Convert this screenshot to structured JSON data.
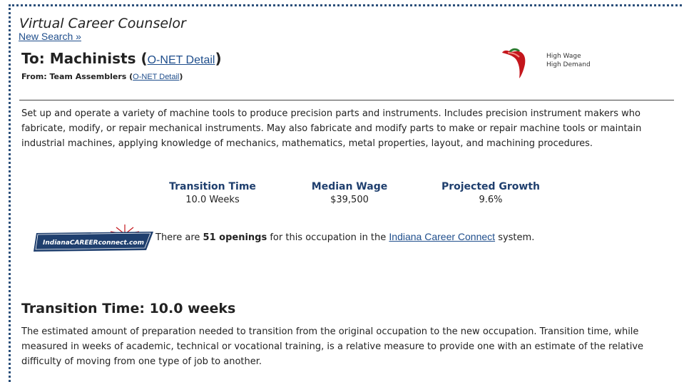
{
  "header": {
    "app_title": "Virtual Career Counselor",
    "new_search_label": "New Search »"
  },
  "occupation": {
    "to_prefix": "To: Machinists (",
    "to_suffix": ")",
    "from_prefix": "From: Team Assemblers (",
    "from_suffix": ")",
    "onet_link_label": "O-NET Detail"
  },
  "badge": {
    "icon": "chili-pepper-icon",
    "line1": "High Wage",
    "line2": "High Demand",
    "color": "#c4161c"
  },
  "description": "Set up and operate a variety of machine tools to produce precision parts and instruments. Includes precision instrument makers who fabricate, modify, or repair mechanical instruments. May also fabricate and modify parts to make or repair machine tools or maintain industrial machines, applying knowledge of mechanics, mathematics, metal properties, layout, and machining procedures.",
  "stats": [
    {
      "label": "Transition Time",
      "value": "10.0 Weeks"
    },
    {
      "label": "Median Wage",
      "value": "$39,500"
    },
    {
      "label": "Projected Growth",
      "value": "9.6%"
    }
  ],
  "openings": {
    "logo_text": "IndianaCAREERconnect.com",
    "prefix": "There are ",
    "count_text": "51 openings",
    "middle": " for this occupation in the ",
    "link_label": "Indiana Career Connect",
    "suffix": " system."
  },
  "transition_section": {
    "heading": "Transition Time: 10.0 weeks",
    "text": "The estimated amount of preparation needed to transition from the original occupation to the new occupation. Transition time, while measured in weeks of academic, technical or vocational training, is a relative measure to provide one with an estimate of the relative difficulty of moving from one type of job to another."
  }
}
